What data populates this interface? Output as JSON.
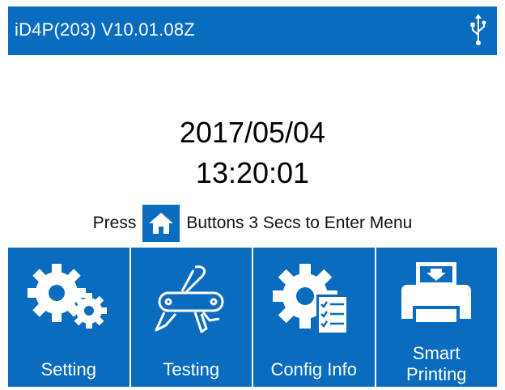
{
  "header": {
    "title": "iD4P(203) V10.01.08Z",
    "status_icon": "usb-icon"
  },
  "clock": {
    "date": "2017/05/04",
    "time": "13:20:01"
  },
  "hint": {
    "prefix": "Press",
    "suffix": "Buttons 3 Secs to Enter Menu",
    "icon": "home-icon"
  },
  "menu": [
    {
      "label": "Setting",
      "icon": "gears-icon"
    },
    {
      "label": "Testing",
      "icon": "multitool-icon"
    },
    {
      "label": "Config Info",
      "icon": "gear-checklist-icon"
    },
    {
      "label": "Smart Printing",
      "icon": "printer-icon"
    }
  ],
  "colors": {
    "accent": "#0a6cbf",
    "text_on_accent": "#ffffff"
  }
}
